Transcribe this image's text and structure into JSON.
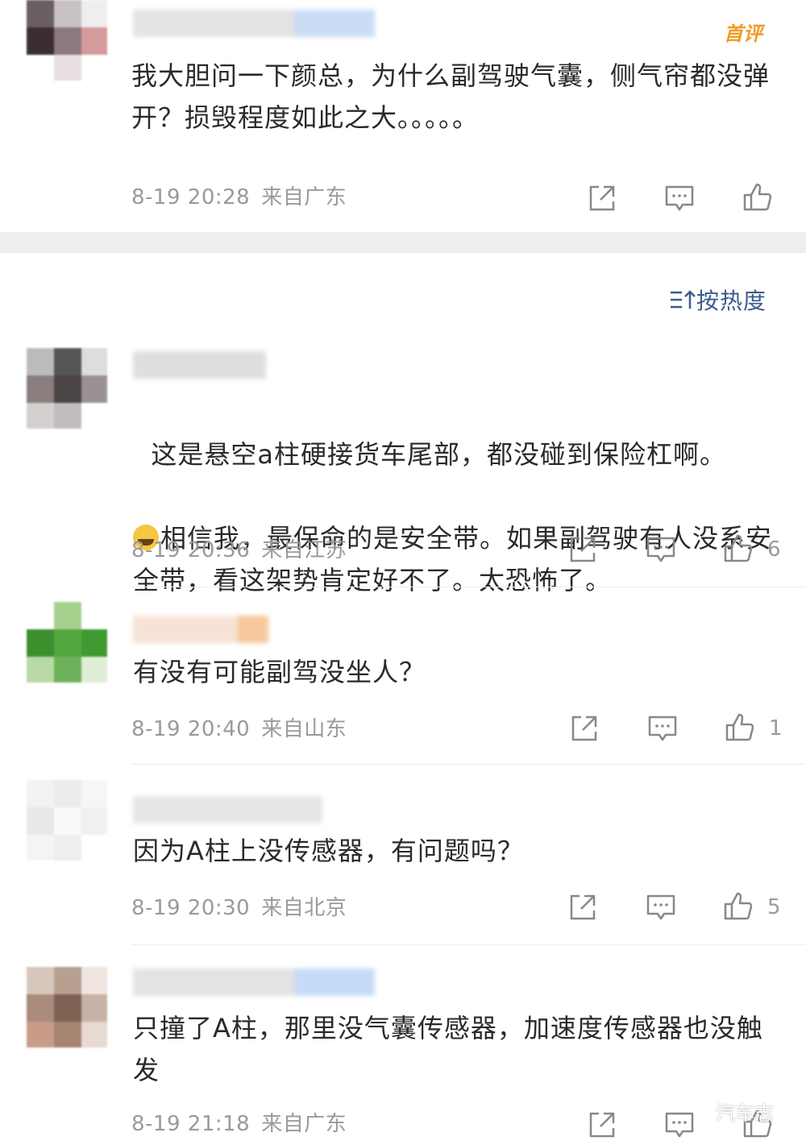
{
  "top_comment": {
    "badge": "首评",
    "text": "我大胆问一下颜总，为什么副驾驶气囊，侧气帘都没弹开？损毁程度如此之大。。。。。",
    "time": "8-19 20:28",
    "location": "来自广东",
    "icons": [
      "share-icon",
      "comment-icon",
      "like-icon"
    ]
  },
  "sort": {
    "label": "按热度",
    "icon": "sort-icon"
  },
  "comments": [
    {
      "text": "这是悬空a柱硬接货车尾部，都没碰到保险杠啊。",
      "text2": "相信我，最保命的是安全带。如果副驾驶有人没系安全带，看这架势肯定好不了。太恐怖了。",
      "time": "8-19 20:36",
      "location": "来自江苏",
      "likes": "6"
    },
    {
      "text": "有没有可能副驾没坐人？",
      "time": "8-19 20:40",
      "location": "来自山东",
      "likes": "1"
    },
    {
      "text": "因为A柱上没传感器，有问题吗？",
      "time": "8-19 20:30",
      "location": "来自北京",
      "likes": "5"
    },
    {
      "text": "只撞了A柱，那里没气囊传感器，加速度传感器也没触发",
      "time": "8-19 21:18",
      "location": "来自广东",
      "likes": ""
    }
  ],
  "watermark": "汽车志",
  "colors": {
    "accent_orange": "#f29a25",
    "link_blue": "#3c5b8c",
    "meta_gray": "#9a9a9a"
  }
}
